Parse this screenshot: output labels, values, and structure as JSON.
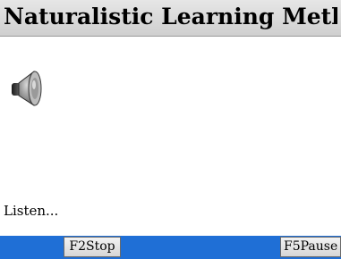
{
  "header": {
    "title": "Naturalistic Learning Meth..."
  },
  "audio": {
    "icon": "speaker-icon"
  },
  "status": {
    "text": "Listen..."
  },
  "softkeys": {
    "left_label": "F2Stop",
    "right_label": "F5Pause"
  },
  "colors": {
    "softkey_bar": "#1f6fd6",
    "title_bar": "#d9d9d9"
  }
}
